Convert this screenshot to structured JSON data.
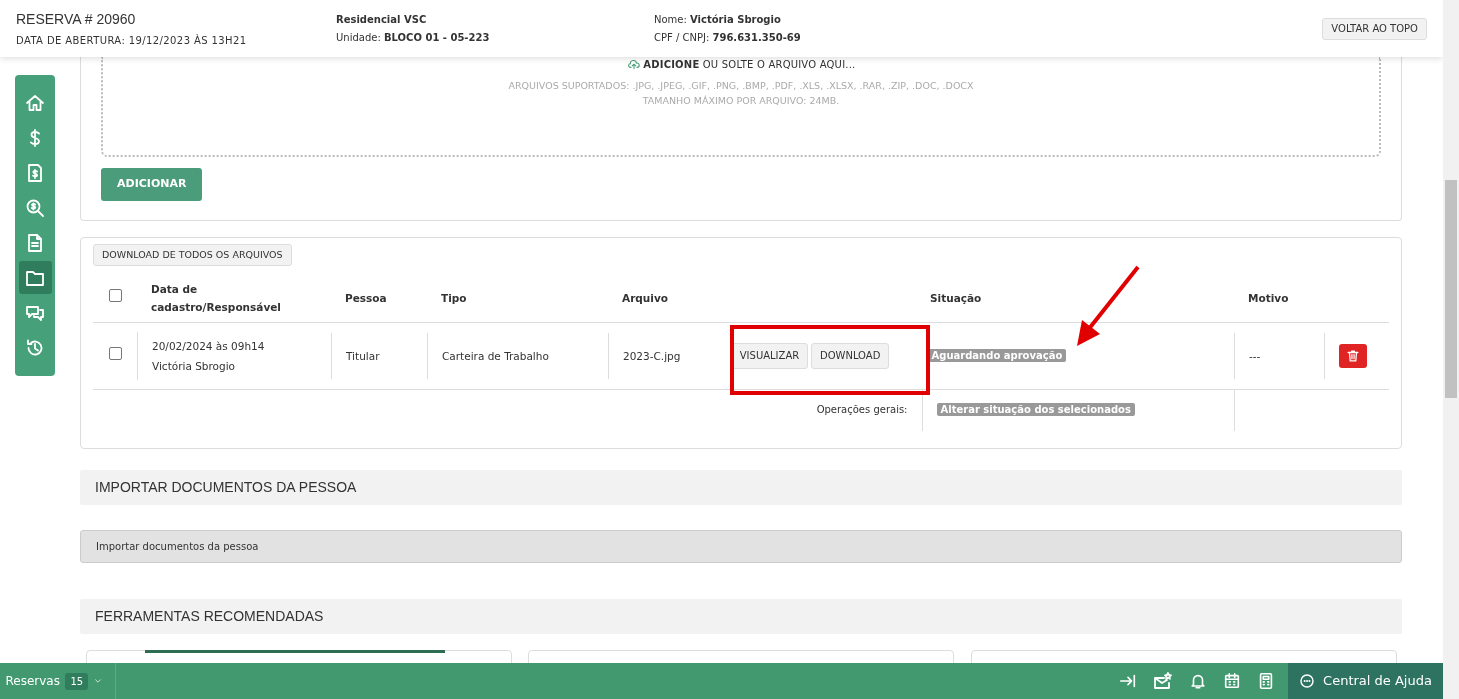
{
  "header": {
    "title": "RESERVA # 20960",
    "opening_date": "DATA DE ABERTURA: 19/12/2023 ÀS 13H21",
    "project": "Residencial VSC",
    "unit_label": "Unidade:",
    "unit": "BLOCO 01 - 05-223",
    "name_label": "Nome:",
    "name": "Victória Sbrogio",
    "doc_label": "CPF / CNPJ:",
    "doc": "796.631.350-69",
    "back_button": "VOLTAR AO TOPO"
  },
  "sidebar": {
    "items": [
      {
        "kind": "home",
        "selected": false
      },
      {
        "kind": "dollar",
        "selected": false
      },
      {
        "kind": "invoice",
        "selected": false
      },
      {
        "kind": "search-dollar",
        "selected": false
      },
      {
        "kind": "document",
        "selected": false
      },
      {
        "kind": "folder",
        "selected": true
      },
      {
        "kind": "chat",
        "selected": false
      },
      {
        "kind": "history",
        "selected": false
      }
    ]
  },
  "upload": {
    "prompt": "**ADICIONE** OU SOLTE O ARQUIVO AQUI...",
    "formats": "ARQUIVOS SUPORTADOS: .JPG, .JPEG, .GIF, .PNG, .BMP, .PDF, .XLS, .XLSX, .RAR, .ZIP, .DOC, .DOCX",
    "max_size": "TAMANHO MÁXIMO POR ARQUIVO: 24MB.",
    "add_button": "ADICIONAR"
  },
  "files": {
    "download_all": "DOWNLOAD DE TODOS OS ARQUIVOS",
    "select_all_checked": false,
    "columns": [
      "Data de cadastro/Responsável",
      "Pessoa",
      "Tipo",
      "Arquivo",
      "Situação",
      "Motivo"
    ],
    "rows": [
      {
        "checked": false,
        "date": "20/02/2024 às 09h14",
        "responsible": "Victória Sbrogio",
        "person": "Titular",
        "type": "Carteira de Trabalho",
        "file": "2023-C.jpg",
        "view_button": "VISUALIZAR",
        "download_button": "DOWNLOAD",
        "status": "Aguardando aprovação",
        "reason": "---"
      }
    ],
    "general_ops_label": "Operações gerais:",
    "bulk_status_button": "Alterar situação dos selecionados"
  },
  "import_section": {
    "title": "IMPORTAR DOCUMENTOS DA PESSOA",
    "bar": "Importar documentos da pessoa"
  },
  "tools_section": {
    "title": "FERRAMENTAS RECOMENDADAS"
  },
  "bottom_bar": {
    "module": "Reservas",
    "count": "15",
    "help": "Central de Ajuda"
  }
}
